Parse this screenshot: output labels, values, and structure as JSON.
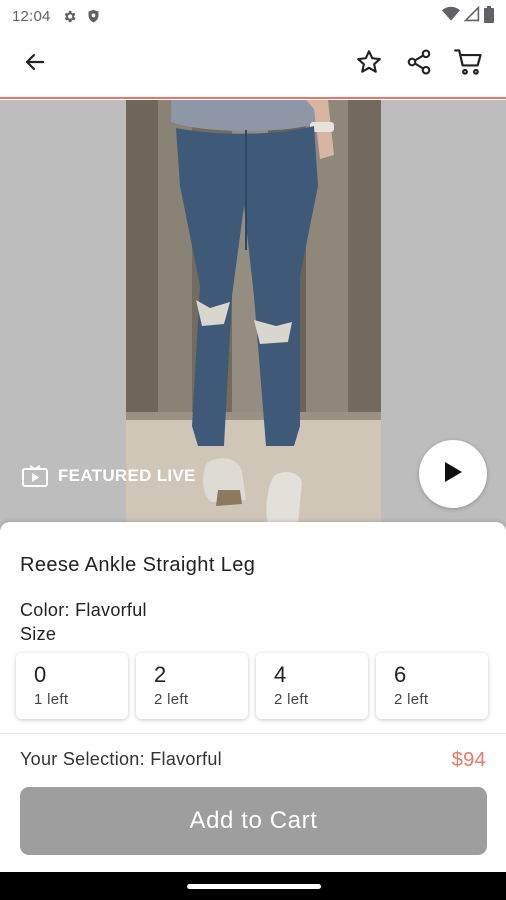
{
  "status_bar": {
    "time": "12:04",
    "icons": [
      "gear-icon",
      "shield-icon",
      "wifi-icon",
      "signal-icon",
      "battery-icon"
    ]
  },
  "app_bar": {
    "icons": [
      "back-arrow-icon",
      "star-icon",
      "share-icon",
      "cart-icon"
    ],
    "accent_color": "#e8776a"
  },
  "media": {
    "badge_label": "FEATURED LIVE",
    "badge_icon": "tv-icon",
    "play_icon": "play-icon"
  },
  "product": {
    "title": "Reese Ankle Straight Leg",
    "color_line": "Color: Flavorful",
    "size_label": "Size",
    "sizes": [
      {
        "value": "0",
        "stock": "1 left"
      },
      {
        "value": "2",
        "stock": "2 left"
      },
      {
        "value": "4",
        "stock": "2 left"
      },
      {
        "value": "6",
        "stock": "2 left"
      }
    ],
    "selection": "Your Selection: Flavorful",
    "price": "$94",
    "price_color": "#e8776a",
    "add_to_cart": "Add to Cart",
    "button_color": "#9e9e9e"
  }
}
